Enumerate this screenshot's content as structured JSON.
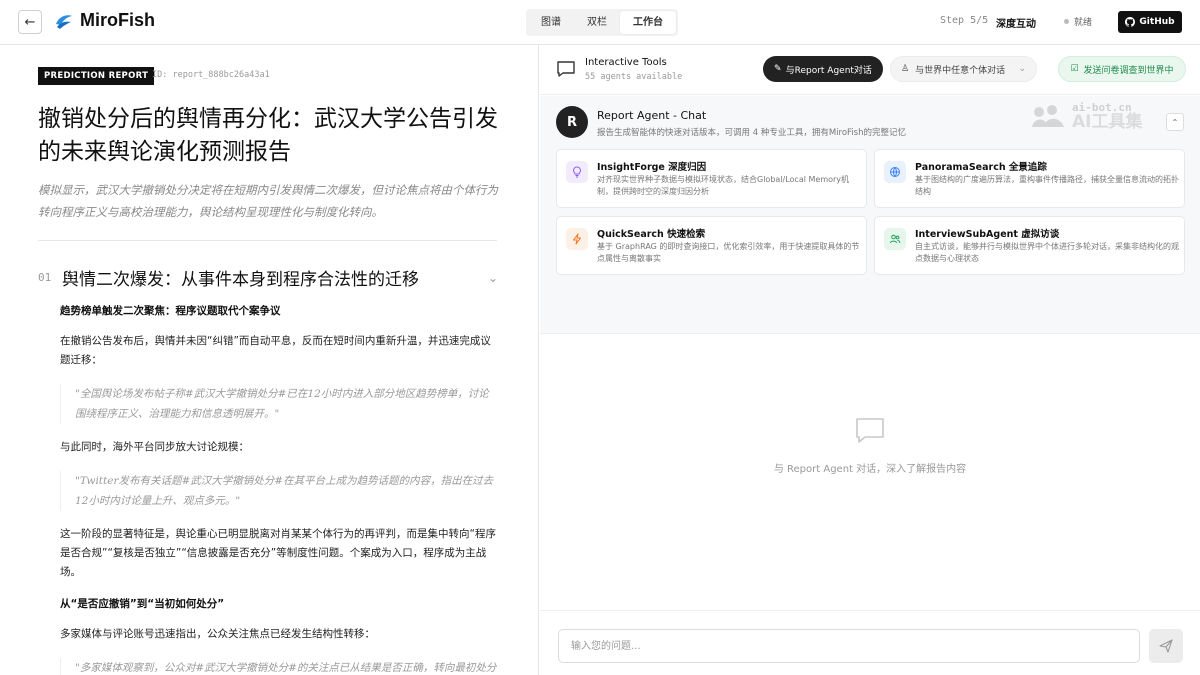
{
  "header": {
    "back_glyph": "←",
    "app_name": "MiroFish",
    "tabs": [
      {
        "label": "图谱",
        "active": false
      },
      {
        "label": "双栏",
        "active": false
      },
      {
        "label": "工作台",
        "active": true
      }
    ],
    "step": "Step 5/5",
    "step_title": "深度互动",
    "status": "就绪",
    "github_label": "GitHub"
  },
  "report": {
    "badge": "PREDICTION REPORT",
    "id": "ID: report_888bc26a43a1",
    "title": "撤销处分后的舆情再分化：武汉大学公告引发的未来舆论演化预测报告",
    "summary": "模拟显示，武汉大学撤销处分决定将在短期内引发舆情二次爆发，但讨论焦点将由个体行为转向程序正义与高校治理能力，舆论结构呈现理性化与制度化转向。",
    "section": {
      "num": "01",
      "title": "舆情二次爆发：从事件本身到程序合法性的迁移",
      "sub1": "趋势榜单触发二次聚焦：程序议题取代个案争议",
      "p1": "在撤销公告发布后，舆情并未因“纠错”而自动平息，反而在短时间内重新升温，并迅速完成议题迁移：",
      "q1": "\"全国舆论场发布帖子称#武汉大学撤销处分#已在12小时内进入部分地区趋势榜单，讨论围绕程序正义、治理能力和信息透明展开。\"",
      "p2": "与此同时，海外平台同步放大讨论规模：",
      "q2": "\"Twitter发布有关话题#武汉大学撤销处分#在其平台上成为趋势话题的内容，指出在过去12小时内讨论量上升、观点多元。\"",
      "p3": "这一阶段的显著特征是，舆论重心已明显脱离对肖某某个体行为的再评判，而是集中转向“程序是否合规”“复核是否独立”“信息披露是否充分”等制度性问题。个案成为入口，程序成为主战场。",
      "sub2": "从“是否应撤销”到“当初如何处分”",
      "p4": "多家媒体与评论账号迅速指出，公众关注焦点已经发生结构性转移：",
      "q3": "\"多家媒体观察到，公众对#武汉大学撤销处分#的关注点已从结果是否正确，转向最初处分"
    }
  },
  "tools": {
    "title": "Interactive Tools",
    "subtitle": "55 agents available",
    "chat_btn": "与Report Agent对话",
    "select_label": "与世界中任意个体对话",
    "survey_btn": "发送问卷调查到世界中"
  },
  "agent": {
    "avatar": "R",
    "name": "Report Agent - Chat",
    "desc": "报告生成智能体的快速对话版本，可调用 4 种专业工具，拥有MiroFish的完整记忆",
    "watermark_top": "ai-bot.cn",
    "watermark_bot": "AI工具集",
    "cards": [
      {
        "name": "InsightForge 深度归因",
        "desc": "对齐现实世界种子数据与模拟环境状态，结合Global/Local Memory机制，提供跨时空的深度归因分析"
      },
      {
        "name": "PanoramaSearch 全景追踪",
        "desc": "基于图结构的广度遍历算法，重构事件传播路径，捕获全量信息流动的拓扑结构"
      },
      {
        "name": "QuickSearch 快速检索",
        "desc": "基于 GraphRAG 的即时查询接口，优化索引效率，用于快速提取具体的节点属性与离散事实"
      },
      {
        "name": "InterviewSubAgent 虚拟访谈",
        "desc": "自主式访谈，能够并行与模拟世界中个体进行多轮对话，采集非结构化的观点数据与心理状态"
      }
    ]
  },
  "chat": {
    "empty_msg": "与 Report Agent 对话，深入了解报告内容",
    "placeholder": "输入您的问题..."
  },
  "colors": {
    "accent_dark": "#222222",
    "survey_green": "#1f8a4c",
    "brand_blue": "#2a8fe0"
  },
  "icons": {
    "card_icons": [
      "lightbulb-icon",
      "globe-icon",
      "bolt-icon",
      "users-icon"
    ]
  }
}
